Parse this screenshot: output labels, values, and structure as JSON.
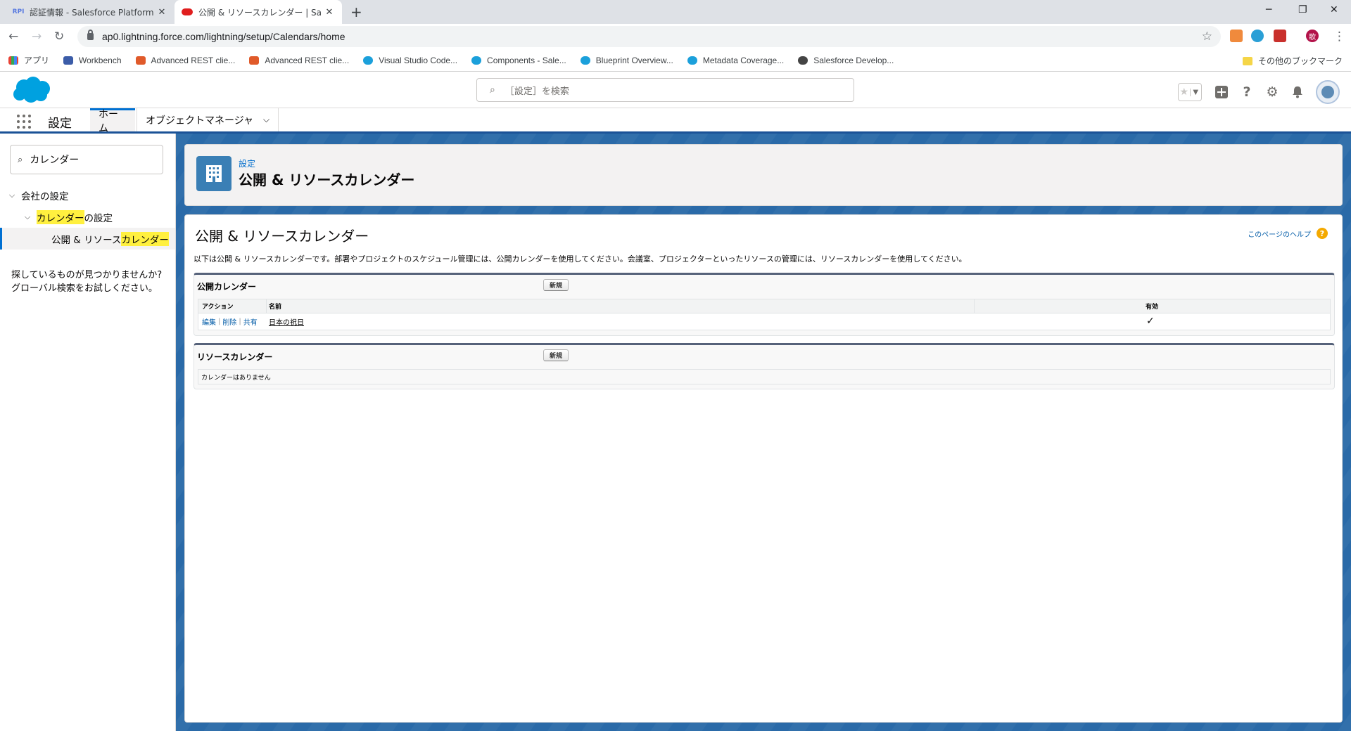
{
  "browser": {
    "tabs": [
      {
        "favicon_text": "RPI",
        "title": "認証情報 - Salesforce Platform A"
      },
      {
        "favicon_text": "",
        "title": "公開 & リソースカレンダー | Salesforc"
      }
    ],
    "url": "ap0.lightning.force.com/lightning/setup/Calendars/home",
    "bookmarks": [
      "アプリ",
      "Workbench",
      "Advanced REST clie...",
      "Advanced REST clie...",
      "Visual Studio Code...",
      "Components - Sale...",
      "Blueprint Overview...",
      "Metadata Coverage...",
      "Salesforce Develop..."
    ],
    "other_bookmarks": "その他のブックマーク",
    "profile_initial": "歌"
  },
  "sf_header": {
    "search_placeholder": "［設定］を検索"
  },
  "nav": {
    "app_name": "設定",
    "home_tab": "ホーム",
    "object_manager": "オブジェクトマネージャ"
  },
  "sidebar": {
    "quick_find_value": "カレンダー",
    "tree": {
      "company": "会社の設定",
      "calendar_hl": "カレンダー",
      "calendar_rest": "の設定",
      "public_prefix": "公開 & リソース",
      "public_hl": "カレンダー"
    },
    "help_line1": "探しているものが見つかりませんか?",
    "help_line2": "グローバル検索をお試しください。"
  },
  "page_header": {
    "breadcrumb": "設定",
    "title": "公開 & リソースカレンダー"
  },
  "content": {
    "title": "公開 & リソースカレンダー",
    "help_link": "このページのヘルプ",
    "intro": "以下は公開 & リソースカレンダーです。部署やプロジェクトのスケジュール管理には、公開カレンダーを使用してください。会議室、プロジェクターといったリソースの管理には、リソースカレンダーを使用してください。",
    "public_calendars": {
      "heading": "公開カレンダー",
      "new_button": "新規",
      "columns": {
        "action": "アクション",
        "name": "名前",
        "active": "有効"
      },
      "rows": [
        {
          "actions": [
            "編集",
            "削除",
            "共有"
          ],
          "name": "日本の祝日",
          "active": "✓"
        }
      ]
    },
    "resource_calendars": {
      "heading": "リソースカレンダー",
      "new_button": "新規",
      "empty": "カレンダーはありません"
    }
  },
  "colors": {
    "brand_blue": "#1b5297",
    "link_blue": "#015ba7",
    "highlight": "#fff03f",
    "setup_icon": "#3a7fb5",
    "help_icon": "#f4a900"
  },
  "icons": [
    "search-icon",
    "star-icon",
    "plus-icon",
    "question-icon",
    "gear-icon",
    "bell-icon",
    "building-icon",
    "lock-icon",
    "waffle-icon"
  ]
}
